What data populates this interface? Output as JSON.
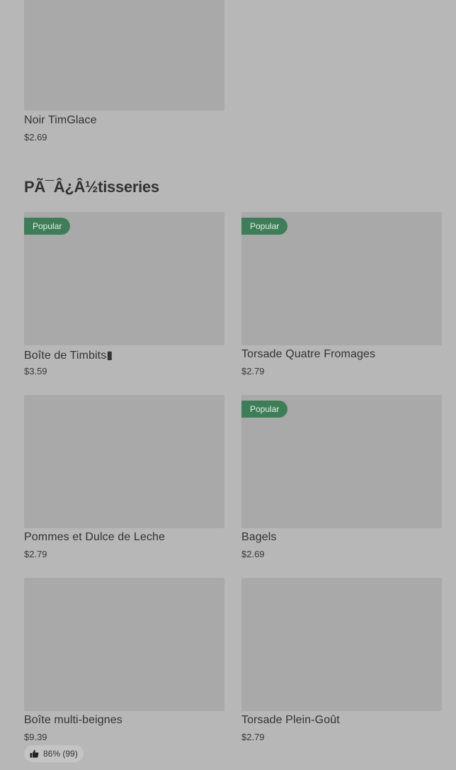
{
  "top_item": {
    "name": "Noir TimGlace",
    "price": "$2.69"
  },
  "section": {
    "title": "PÃ¯Â¿Â½tisseries"
  },
  "items": [
    {
      "name": "Boîte de Timbits▮",
      "price": "$3.59",
      "badge": "Popular"
    },
    {
      "name": "Torsade Quatre Fromages",
      "price": "$2.79",
      "badge": "Popular"
    },
    {
      "name": "Pommes et Dulce de Leche",
      "price": "$2.79",
      "badge": ""
    },
    {
      "name": "Bagels",
      "price": "$2.69",
      "badge": "Popular"
    },
    {
      "name": "Boîte multi-beignes",
      "price": "$9.39",
      "badge": "",
      "rating": "86% (99)"
    },
    {
      "name": "Torsade Plein-Goût",
      "price": "$2.79",
      "badge": ""
    }
  ],
  "icons": {
    "rating": "thumbs-up-icon"
  }
}
